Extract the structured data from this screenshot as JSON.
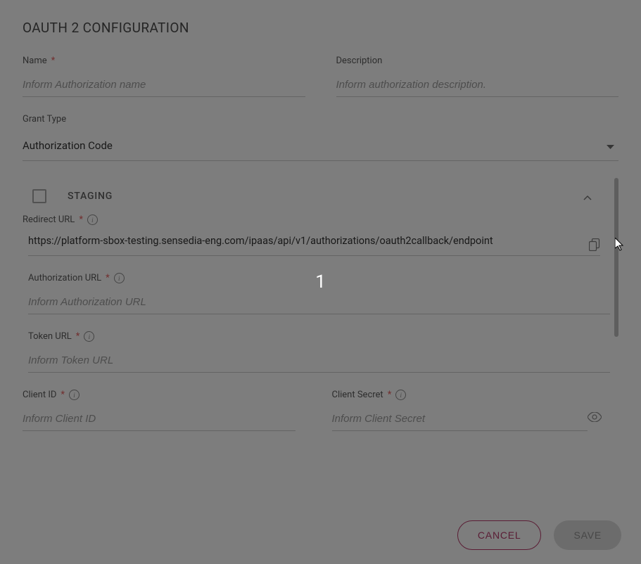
{
  "title": "OAUTH 2 CONFIGURATION",
  "overlay_number": "1",
  "name": {
    "label": "Name",
    "placeholder": "Inform Authorization name"
  },
  "description": {
    "label": "Description",
    "placeholder": "Inform authorization description."
  },
  "grant_type": {
    "label": "Grant Type",
    "value": "Authorization Code"
  },
  "staging": {
    "label": "STAGING"
  },
  "redirect_url": {
    "label": "Redirect URL",
    "value": "https://platform-sbox-testing.sensedia-eng.com/ipaas/api/v1/authorizations/oauth2callback/endpoint"
  },
  "authorization_url": {
    "label": "Authorization URL",
    "placeholder": "Inform Authorization URL"
  },
  "token_url": {
    "label": "Token URL",
    "placeholder": "Inform Token URL"
  },
  "client_id": {
    "label": "Client ID",
    "placeholder": "Inform Client ID"
  },
  "client_secret": {
    "label": "Client Secret",
    "placeholder": "Inform Client Secret"
  },
  "buttons": {
    "cancel": "CANCEL",
    "save": "SAVE"
  }
}
